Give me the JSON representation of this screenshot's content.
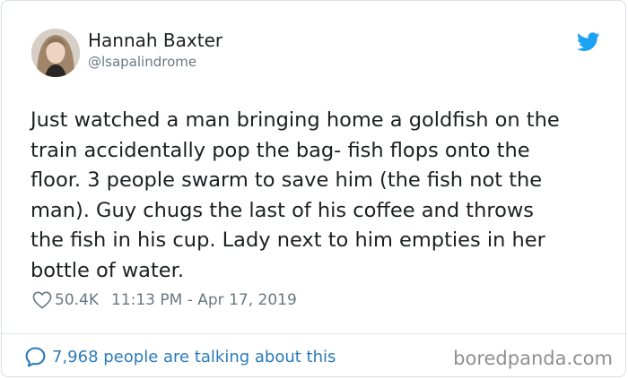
{
  "tweet": {
    "author": {
      "display_name": "Hannah Baxter",
      "handle": "@lsapalindrome"
    },
    "text": "Just watched a man bringing home a goldfish on the\ntrain accidentally pop the bag- fish flops onto the\nfloor. 3 people swarm to save him (the fish not the\nman). Guy chugs the last of his coffee and throws\nthe fish in his cup. Lady next to him empties in her\nbottle of water.",
    "likes": "50.4K",
    "timestamp": "11:13 PM - Apr 17, 2019",
    "conversation": "7,968 people are talking about this"
  },
  "icons": {
    "logo": "twitter-bird-icon",
    "like": "heart-icon",
    "reply": "speech-bubble-icon"
  },
  "watermark": "boredpanda.com",
  "colors": {
    "text": "#1c2022",
    "secondary": "#697882",
    "twitter_blue": "#1da1f2",
    "link_blue": "#2b7bb9",
    "watermark_gray": "#8f8f8f",
    "border": "#d9dfe4"
  }
}
